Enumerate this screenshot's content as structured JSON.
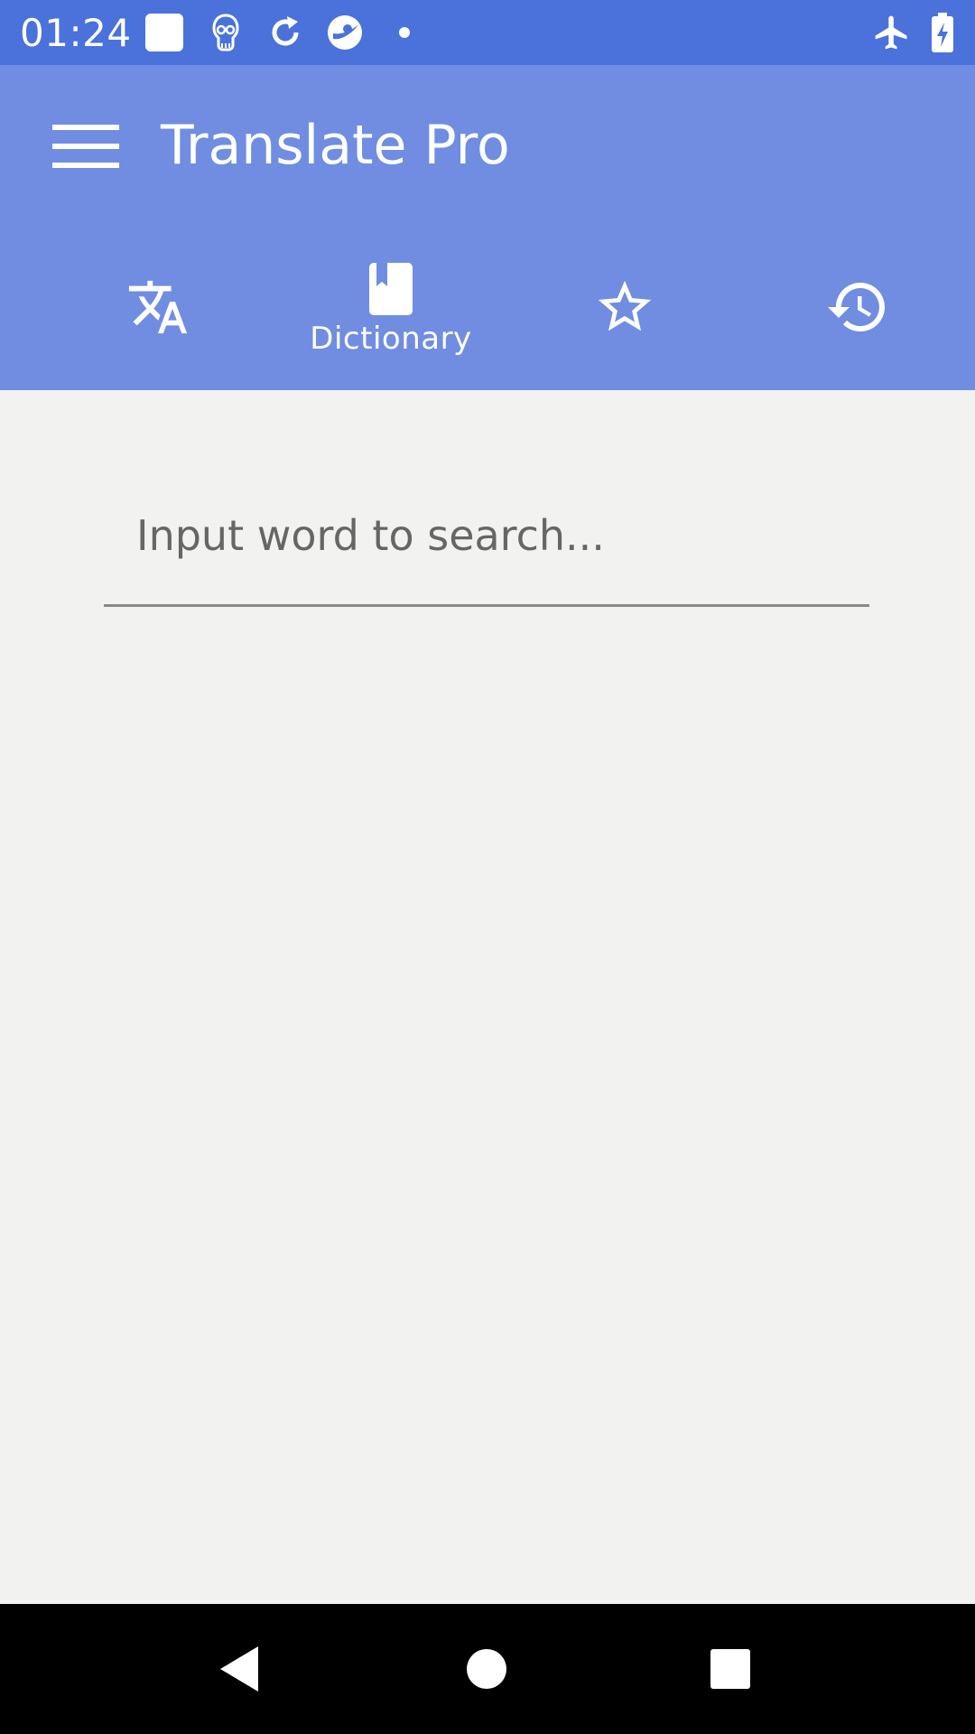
{
  "status_bar": {
    "time": "01:24",
    "background": "#4a72da",
    "icons": [
      "square-notification-icon",
      "skull-icon",
      "sync-icon",
      "browser-icon",
      "dot-icon",
      "airplane-mode-icon",
      "battery-charging-icon"
    ]
  },
  "app_bar": {
    "title": "Translate Pro",
    "background": "#708de1",
    "menu_icon": "hamburger-menu-icon"
  },
  "tabs": [
    {
      "id": "translate",
      "icon": "translate-icon",
      "label": "",
      "selected": false
    },
    {
      "id": "dictionary",
      "icon": "book-icon",
      "label": "Dictionary",
      "selected": true
    },
    {
      "id": "favorites",
      "icon": "star-outline-icon",
      "label": "",
      "selected": false
    },
    {
      "id": "history",
      "icon": "history-icon",
      "label": "",
      "selected": false
    }
  ],
  "search": {
    "value": "",
    "placeholder": "Input word to search..."
  },
  "nav_bar": {
    "buttons": [
      "back-icon",
      "home-icon",
      "recents-icon"
    ]
  }
}
